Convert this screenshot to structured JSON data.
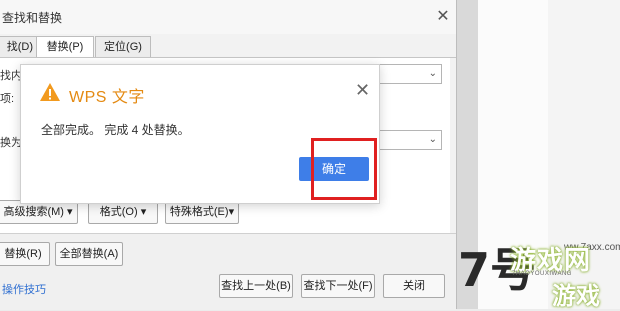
{
  "dialog": {
    "title": "查找和替换",
    "close_icon": "close-icon",
    "tabs": [
      {
        "label": "找(D)",
        "active": false
      },
      {
        "label": "替换(P)",
        "active": true
      },
      {
        "label": "定位(G)",
        "active": false
      }
    ],
    "find_label": "找内容",
    "options_label": "项:",
    "replace_label": "换为(I)",
    "buttons": {
      "advanced": "高级搜索(M)",
      "format": "格式(O)",
      "special": "特殊格式(E)",
      "replace": "替换(R)",
      "replace_all": "全部替换(A)",
      "find_prev": "查找上一处(B)",
      "find_next": "查找下一处(F)",
      "close": "关闭"
    },
    "tips_link": "操作技巧"
  },
  "message": {
    "title": "WPS 文字",
    "text": "全部完成。 完成 4 处替换。",
    "ok": "确定",
    "icon": "warning-icon",
    "accent": "#e48a12",
    "button_color": "#3e7ee8",
    "highlight_color": "#e02020"
  },
  "watermark": {
    "number": "7号",
    "top_text": "游戏网",
    "small_text": "7HAOYOUXIWANG",
    "bottom_text": "游戏",
    "url": "ww.7axx.com"
  }
}
